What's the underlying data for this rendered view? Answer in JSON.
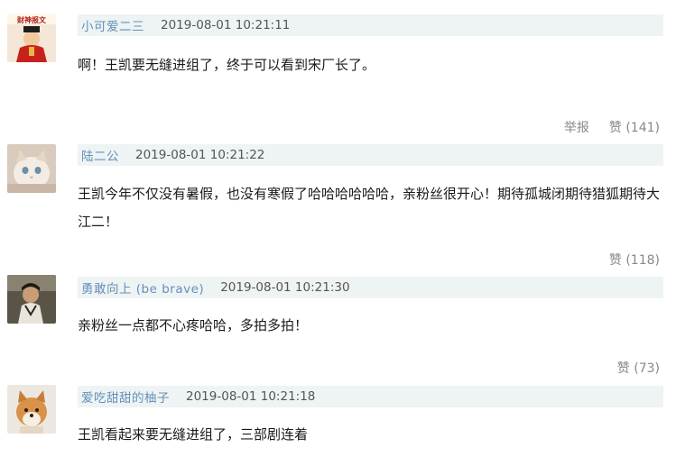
{
  "comments": [
    {
      "username": "小可爱二三",
      "timestamp": "2019-08-01 10:21:11",
      "text": "啊！王凯要无缝进组了，终于可以看到宋厂长了。",
      "report_label": "举报",
      "like_label": "赞 (141)"
    },
    {
      "username": "陆二公",
      "timestamp": "2019-08-01 10:21:22",
      "text": "王凯今年不仅没有暑假，也没有寒假了哈哈哈哈哈哈，亲粉丝很开心！期待孤城闭期待猎狐期待大江二！",
      "like_label": "赞 (118)"
    },
    {
      "username": "勇敢向上 (be brave)",
      "timestamp": "2019-08-01 10:21:30",
      "text": "亲粉丝一点都不心疼哈哈，多拍多拍！",
      "like_label": "赞 (73)"
    },
    {
      "username": "爱吃甜甜的柚子",
      "timestamp": "2019-08-01 10:21:18",
      "text": "王凯看起来要无缝进组了，三部剧连着"
    }
  ],
  "avatars": [
    {
      "icon": "caishen-avatar-icon",
      "text": "财神报文"
    },
    {
      "icon": "cat-avatar-icon"
    },
    {
      "icon": "person-avatar-icon"
    },
    {
      "icon": "shiba-dog-avatar-icon"
    }
  ],
  "colors": {
    "meta_bar_bg": "#eef3f3",
    "username": "#4d7fb0",
    "action": "#888888"
  }
}
